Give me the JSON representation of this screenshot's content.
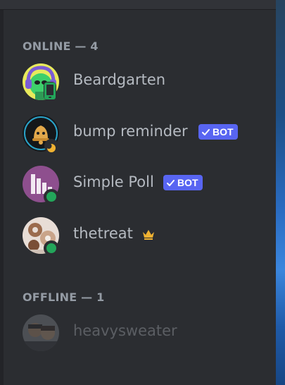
{
  "sections": {
    "online": {
      "label": "ONLINE — 4"
    },
    "offline": {
      "label": "OFFLINE — 1"
    }
  },
  "members": {
    "beardgarten": {
      "name": "Beardgarten",
      "status": "mobile-online",
      "avatar_icon": "alien-headphones-avatar"
    },
    "bump_reminder": {
      "name": "bump reminder",
      "bot_label": "BOT",
      "status": "idle",
      "avatar_icon": "bell-avatar"
    },
    "simple_poll": {
      "name": "Simple Poll",
      "bot_label": "BOT",
      "status": "online",
      "avatar_icon": "bar-chart-avatar"
    },
    "thetreat": {
      "name": "thetreat",
      "status": "online",
      "owner_icon": "crown-icon",
      "avatar_icon": "photo-avatar"
    },
    "heavysweater": {
      "name": "heavysweater",
      "status": "offline",
      "avatar_icon": "photo-avatar"
    }
  },
  "colors": {
    "panel_bg": "#2b2d31",
    "header_text": "#949ba4",
    "member_text": "#b5bac1",
    "offline_text": "#4e5058",
    "online_green": "#23a55a",
    "idle_orange": "#f0b232",
    "bot_tag": "#5865f2",
    "crown_gold": "#f0b232"
  }
}
